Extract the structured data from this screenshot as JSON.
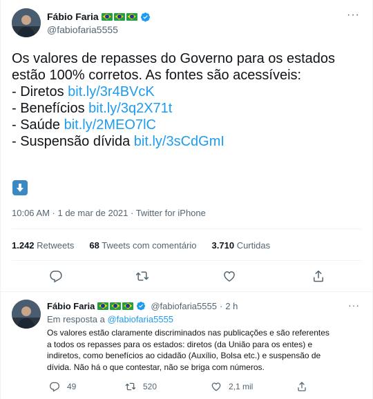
{
  "main_tweet": {
    "author_name": "Fábio Faria",
    "handle": "@fabiofaria5555",
    "more_icon": "more-horizontal-icon",
    "text_intro": [
      "Os valores de repasses do Governo para os estados",
      "estão 100% corretos. As fontes são acessíveis:"
    ],
    "list": [
      {
        "prefix": "- Diretos ",
        "link": "bit.ly/3r4BVcK"
      },
      {
        "prefix": "- Benefícios ",
        "link": "bit.ly/3q2X71t"
      },
      {
        "prefix": "- Saúde ",
        "link": "bit.ly/2MEO7lC"
      },
      {
        "prefix": "- Suspensão dívida ",
        "link": "bit.ly/3sCdGmI"
      }
    ],
    "emoji": "down-arrow-emoji",
    "time": "10:06 AM · 1 de mar de 2021 · ",
    "source": "Twitter for iPhone",
    "stats": {
      "retweets_count": "1.242",
      "retweets_label": "Retweets",
      "comments_count": "68",
      "comments_label": "Tweets com comentário",
      "likes_count": "3.710",
      "likes_label": "Curtidas"
    },
    "colors": {
      "link": "#1d9bf0",
      "secondary": "#536471",
      "text": "#0f1419",
      "verified": "#1d9bf0"
    }
  },
  "reply_tweet": {
    "author_name": "Fábio Faria",
    "handle": "@fabiofaria5555",
    "separator": "·",
    "time": "2 h",
    "in_reply_prefix": "Em resposta a ",
    "in_reply_handle": "@fabiofaria5555",
    "text": [
      "Os valores estão claramente discriminados nas publicações e são referentes",
      "a todos os repasses para os estados: diretos (da União para os entes) e",
      "indiretos, como benefícios ao cidadão (Auxílio, Bolsa etc.) e suspensão de",
      "dívida. Não há o que contestar, não se briga com números."
    ],
    "replies_count": "49",
    "retweets_count": "520",
    "likes_count": "2,1 mil"
  }
}
